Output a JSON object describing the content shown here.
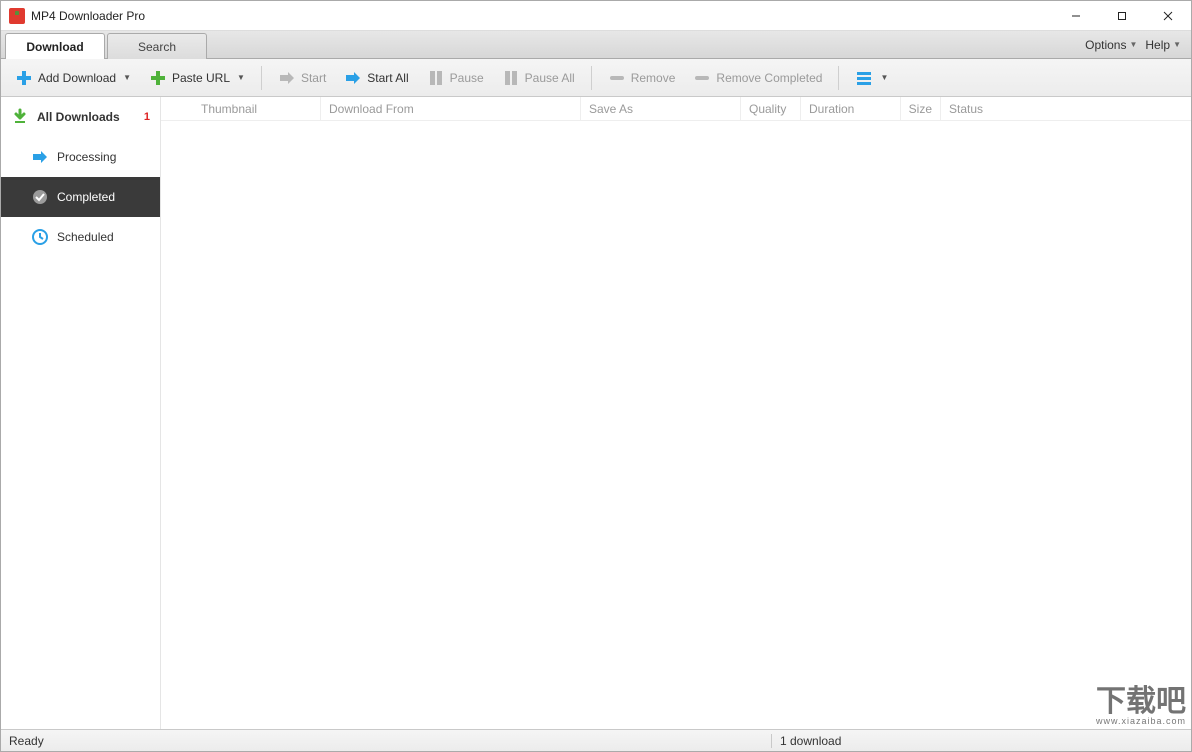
{
  "app": {
    "title": "MP4 Downloader Pro"
  },
  "tabs": {
    "download": "Download",
    "search": "Search"
  },
  "menu": {
    "options": "Options",
    "help": "Help"
  },
  "toolbar": {
    "add_download": "Add Download",
    "paste_url": "Paste URL",
    "start": "Start",
    "start_all": "Start All",
    "pause": "Pause",
    "pause_all": "Pause All",
    "remove": "Remove",
    "remove_completed": "Remove Completed"
  },
  "sidebar": {
    "all_downloads": "All Downloads",
    "all_downloads_badge": "1",
    "processing": "Processing",
    "completed": "Completed",
    "scheduled": "Scheduled"
  },
  "columns": {
    "thumbnail": "Thumbnail",
    "download_from": "Download From",
    "save_as": "Save As",
    "quality": "Quality",
    "duration": "Duration",
    "size": "Size",
    "status": "Status"
  },
  "status": {
    "ready": "Ready",
    "count": "1 download"
  },
  "watermark": {
    "main": "下载吧",
    "sub": "www.xiazaiba.com"
  }
}
